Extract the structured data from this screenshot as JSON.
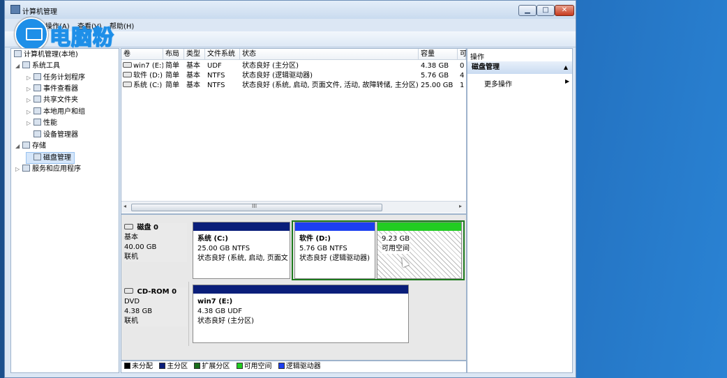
{
  "window": {
    "title": "计算机管理"
  },
  "logo": {
    "text": "电脑粉"
  },
  "menu": [
    {
      "label": "操作(A)"
    },
    {
      "label": "查看(V)"
    },
    {
      "label": "帮助(H)"
    }
  ],
  "tree": {
    "root": "计算机管理(本地)",
    "items": [
      {
        "label": "系统工具",
        "arrow": "◢"
      },
      {
        "label": "任务计划程序",
        "arrow": "▷"
      },
      {
        "label": "事件查看器",
        "arrow": "▷"
      },
      {
        "label": "共享文件夹",
        "arrow": "▷"
      },
      {
        "label": "本地用户和组",
        "arrow": "▷"
      },
      {
        "label": "性能",
        "arrow": "▷"
      },
      {
        "label": "设备管理器",
        "arrow": ""
      },
      {
        "label": "存储",
        "arrow": "◢"
      },
      {
        "label": "磁盘管理",
        "arrow": ""
      },
      {
        "label": "服务和应用程序",
        "arrow": "▷"
      }
    ]
  },
  "volumes": {
    "columns": [
      "卷",
      "布局",
      "类型",
      "文件系统",
      "状态",
      "容量",
      "可"
    ],
    "rows": [
      {
        "name": "win7 (E:)",
        "layout": "简单",
        "type": "基本",
        "fs": "UDF",
        "status": "状态良好 (主分区)",
        "capacity": "4.38 GB",
        "free": "0"
      },
      {
        "name": "软件 (D:)",
        "layout": "简单",
        "type": "基本",
        "fs": "NTFS",
        "status": "状态良好 (逻辑驱动器)",
        "capacity": "5.76 GB",
        "free": "4"
      },
      {
        "name": "系统 (C:)",
        "layout": "简单",
        "type": "基本",
        "fs": "NTFS",
        "status": "状态良好 (系统, 启动, 页面文件, 活动, 故障转储, 主分区)",
        "capacity": "25.00 GB",
        "free": "1"
      }
    ],
    "scroll_label": "III"
  },
  "disks": [
    {
      "name": "磁盘 0",
      "type": "基本",
      "size": "40.00 GB",
      "state": "联机",
      "partitions": [
        {
          "title": "系统  (C:)",
          "size": "25.00 GB NTFS",
          "status": "状态良好 (系统, 启动, 页面文",
          "bar_color": "#0a1e7a",
          "hatched": false
        },
        {
          "title": "软件  (D:)",
          "size": "5.76 GB NTFS",
          "status": "状态良好 (逻辑驱动器)",
          "bar_color": "#1c3ff0",
          "hatched": false
        },
        {
          "title": "",
          "size": "9.23 GB",
          "status": "可用空间",
          "bar_color": "#22cc22",
          "hatched": true
        }
      ]
    },
    {
      "name": "CD-ROM 0",
      "type": "DVD",
      "size": "4.38 GB",
      "state": "联机",
      "partitions": [
        {
          "title": "win7  (E:)",
          "size": "4.38 GB UDF",
          "status": "状态良好 (主分区)",
          "bar_color": "#0a1e7a",
          "hatched": false
        }
      ]
    }
  ],
  "legend": [
    {
      "label": "未分配",
      "color": "#000000"
    },
    {
      "label": "主分区",
      "color": "#0a1e7a"
    },
    {
      "label": "扩展分区",
      "color": "#1a6e1a"
    },
    {
      "label": "可用空间",
      "color": "#22cc22"
    },
    {
      "label": "逻辑驱动器",
      "color": "#1c3ff0"
    }
  ],
  "actions": {
    "title": "操作",
    "group": "磁盘管理",
    "item": "更多操作"
  }
}
